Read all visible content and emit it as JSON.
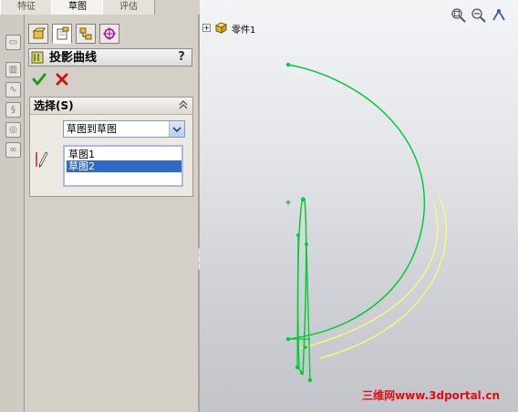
{
  "tabs": [
    "特征",
    "草图",
    "评估"
  ],
  "active_tab": "草图",
  "property_manager": {
    "title": "投影曲线",
    "help_label": "?",
    "selection_group": {
      "title": "选择(S)",
      "projection_mode": "草图到草图",
      "sketches": [
        "草图1",
        "草图2"
      ],
      "selected_sketch": "草图2"
    }
  },
  "feature_tree": {
    "expand_label": "+",
    "part_label": "零件1"
  },
  "watermark": "三维网www.3dportal.cn",
  "colors": {
    "sketch_green": "#00cc33",
    "projected_yellow": "#ffff66",
    "selection_blue": "#316ac5",
    "watermark_red": "#e10f0f"
  },
  "icons": {
    "ok": "check-icon",
    "cancel": "x-icon",
    "help": "help-icon",
    "collapse": "chevron-up-icon"
  }
}
